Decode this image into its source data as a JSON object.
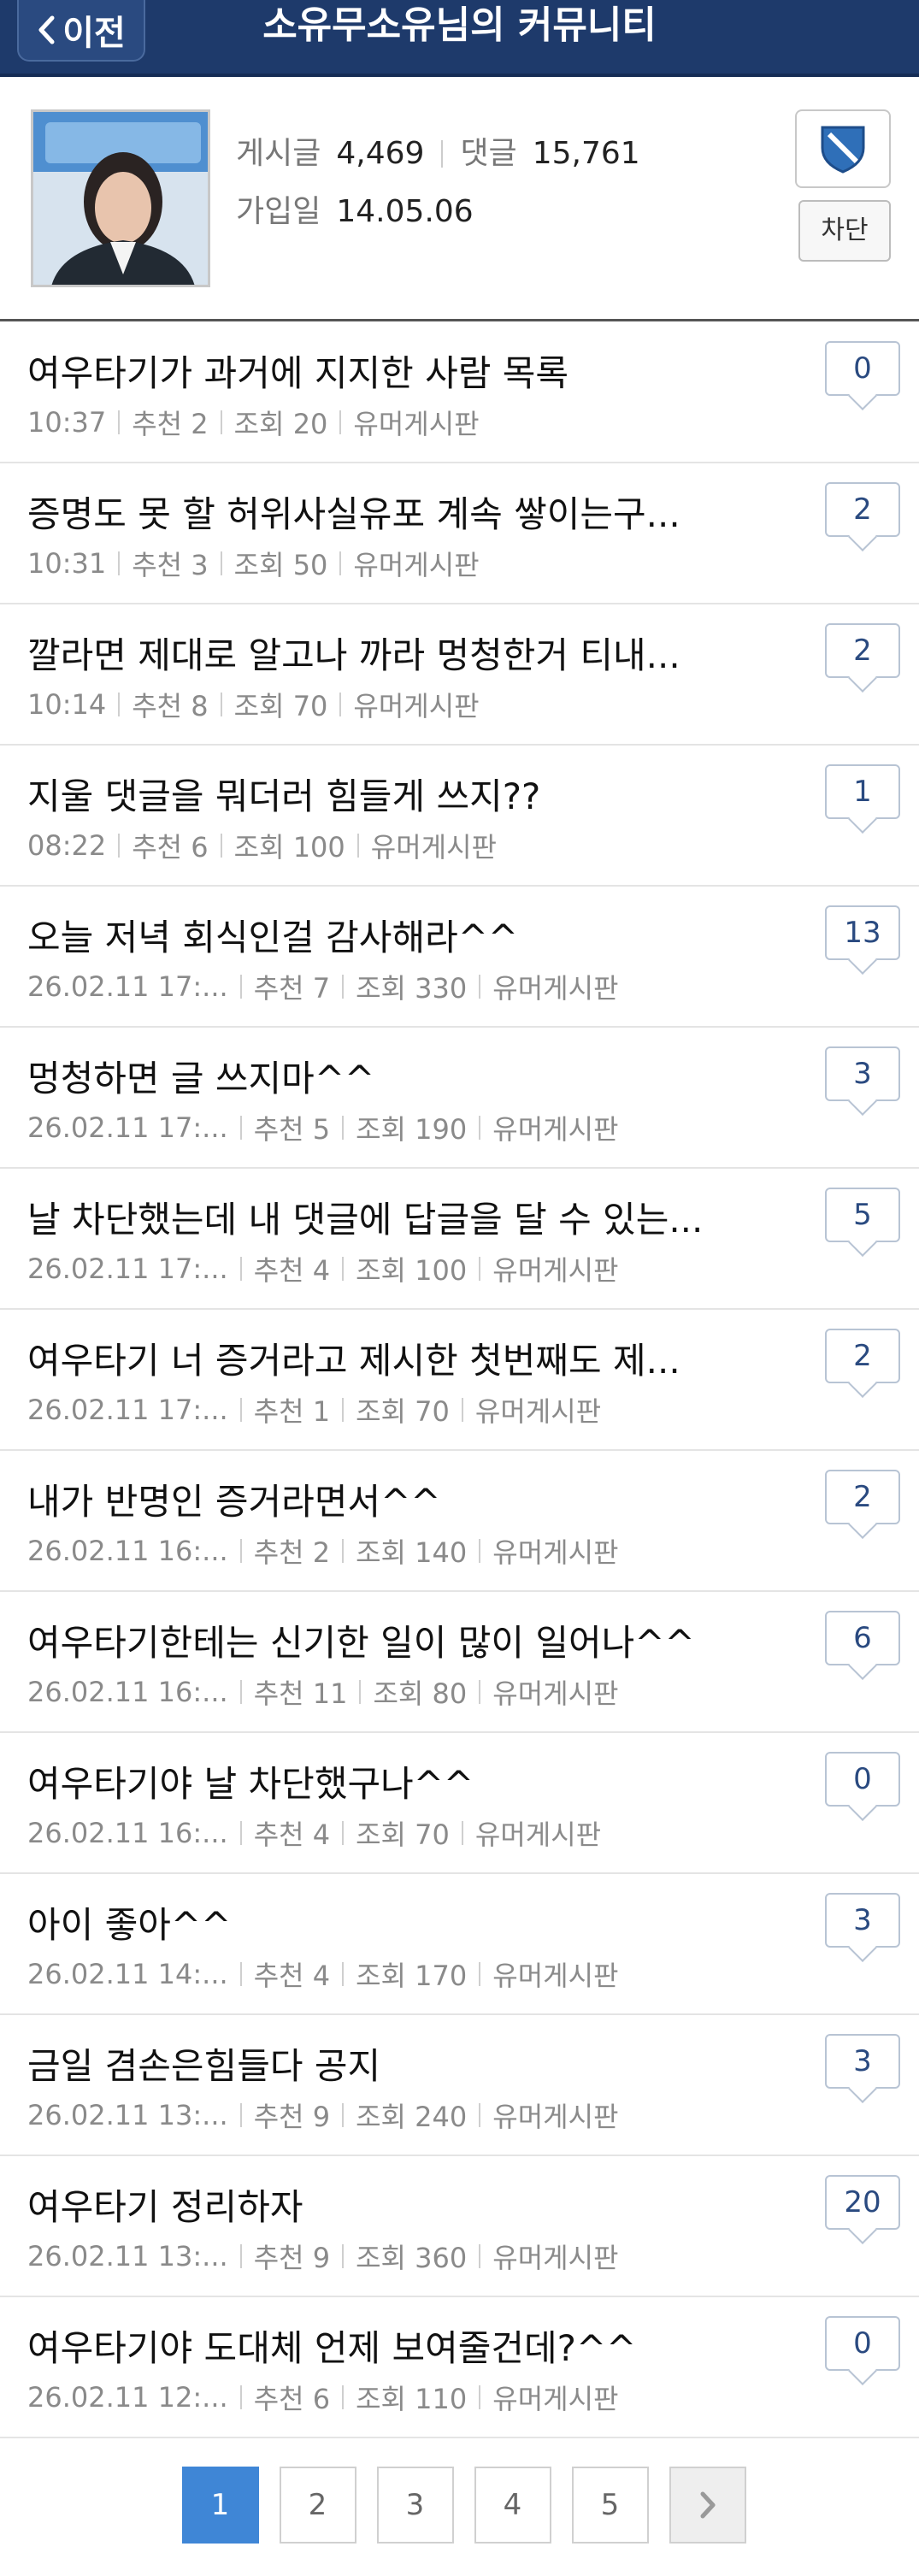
{
  "header": {
    "back_label": "이전",
    "title": "소유무소유님의 커뮤니티"
  },
  "profile": {
    "posts_label": "게시글",
    "posts_count": "4,469",
    "comments_label": "댓글",
    "comments_count": "15,761",
    "joined_label": "가입일",
    "joined_date": "14.05.06",
    "block_label": "차단"
  },
  "posts": [
    {
      "title": "여우타기가 과거에 지지한 사람 목록",
      "time": "10:37",
      "rec": "추천 2",
      "views": "조회 20",
      "board": "유머게시판",
      "comments": "0"
    },
    {
      "title": "증명도 못 할 허위사실유포 계속 쌓이는구...",
      "time": "10:31",
      "rec": "추천 3",
      "views": "조회 50",
      "board": "유머게시판",
      "comments": "2"
    },
    {
      "title": "깔라면 제대로 알고나 까라 멍청한거 티내...",
      "time": "10:14",
      "rec": "추천 8",
      "views": "조회 70",
      "board": "유머게시판",
      "comments": "2"
    },
    {
      "title": "지울 댓글을 뭐더러 힘들게 쓰지??",
      "time": "08:22",
      "rec": "추천 6",
      "views": "조회 100",
      "board": "유머게시판",
      "comments": "1"
    },
    {
      "title": "오늘 저녁 회식인걸 감사해라^^",
      "time": "26.02.11  17:...",
      "rec": "추천 7",
      "views": "조회 330",
      "board": "유머게시판",
      "comments": "13"
    },
    {
      "title": "멍청하면 글 쓰지마^^",
      "time": "26.02.11  17:...",
      "rec": "추천 5",
      "views": "조회 190",
      "board": "유머게시판",
      "comments": "3"
    },
    {
      "title": "날 차단했는데 내 댓글에 답글을 달 수 있는...",
      "time": "26.02.11  17:...",
      "rec": "추천 4",
      "views": "조회 100",
      "board": "유머게시판",
      "comments": "5"
    },
    {
      "title": "여우타기 너 증거라고 제시한 첫번째도 제...",
      "time": "26.02.11  17:...",
      "rec": "추천 1",
      "views": "조회 70",
      "board": "유머게시판",
      "comments": "2"
    },
    {
      "title": "내가 반명인 증거라면서^^",
      "time": "26.02.11  16:...",
      "rec": "추천 2",
      "views": "조회 140",
      "board": "유머게시판",
      "comments": "2"
    },
    {
      "title": "여우타기한테는 신기한 일이 많이 일어나^^",
      "time": "26.02.11  16:...",
      "rec": "추천 11",
      "views": "조회 80",
      "board": "유머게시판",
      "comments": "6"
    },
    {
      "title": "여우타기야 날 차단했구나^^",
      "time": "26.02.11  16:...",
      "rec": "추천 4",
      "views": "조회 70",
      "board": "유머게시판",
      "comments": "0"
    },
    {
      "title": "아이 좋아^^",
      "time": "26.02.11  14:...",
      "rec": "추천 4",
      "views": "조회 170",
      "board": "유머게시판",
      "comments": "3"
    },
    {
      "title": "금일 겸손은힘들다 공지",
      "time": "26.02.11  13:...",
      "rec": "추천 9",
      "views": "조회 240",
      "board": "유머게시판",
      "comments": "3"
    },
    {
      "title": "여우타기 정리하자",
      "time": "26.02.11  13:...",
      "rec": "추천 9",
      "views": "조회 360",
      "board": "유머게시판",
      "comments": "20"
    },
    {
      "title": "여우타기야 도대체 언제 보여줄건데?^^",
      "time": "26.02.11  12:...",
      "rec": "추천 6",
      "views": "조회 110",
      "board": "유머게시판",
      "comments": "0"
    }
  ],
  "pagination": {
    "pages": [
      "1",
      "2",
      "3",
      "4",
      "5"
    ],
    "current": "1"
  },
  "colors": {
    "header": "#1e3a6b",
    "accent": "#3f86d6",
    "bubble_text": "#2a4a80"
  }
}
